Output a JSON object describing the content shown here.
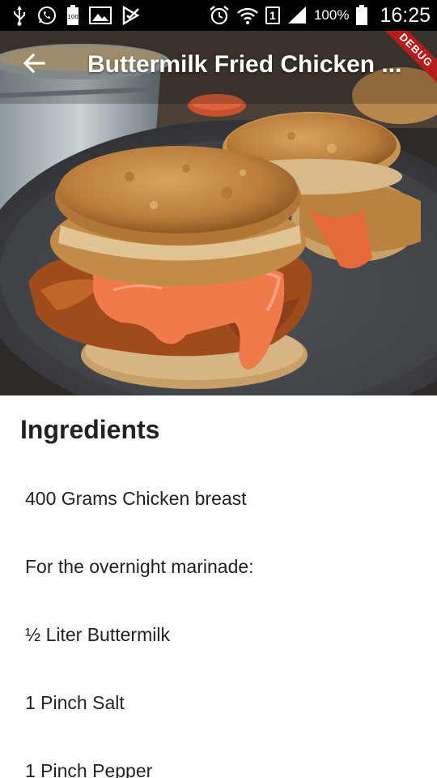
{
  "status_bar": {
    "battery_percent": "100%",
    "time": "16:25",
    "sim_slot": "1",
    "icons": [
      "usb-icon",
      "whatsapp-icon",
      "battery-full-icon",
      "gallery-icon",
      "checkmark-icon",
      "alarm-icon",
      "wifi-icon",
      "signal-icon",
      "battery-icon"
    ]
  },
  "app_bar": {
    "title": "Buttermilk Fried Chicken ...",
    "back_icon": "arrow-back-icon"
  },
  "debug_banner": "DEBUG",
  "ingredients": {
    "heading": "Ingredients",
    "items": [
      "400 Grams Chicken breast",
      "For the overnight marinade:",
      "½ Liter Buttermilk",
      "1 Pinch Salt",
      "1 Pinch Pepper"
    ]
  }
}
